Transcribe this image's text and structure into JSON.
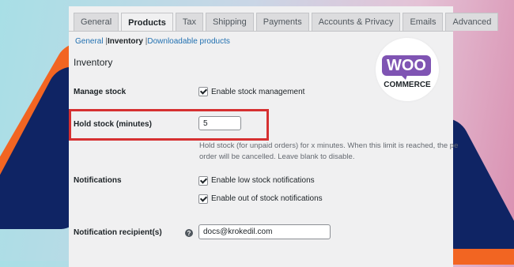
{
  "tabs": [
    {
      "label": "General",
      "active": false
    },
    {
      "label": "Products",
      "active": true
    },
    {
      "label": "Tax",
      "active": false
    },
    {
      "label": "Shipping",
      "active": false
    },
    {
      "label": "Payments",
      "active": false
    },
    {
      "label": "Accounts & Privacy",
      "active": false
    },
    {
      "label": "Emails",
      "active": false
    },
    {
      "label": "Advanced",
      "active": false
    }
  ],
  "subnav": {
    "general": "General",
    "inventory": "Inventory",
    "downloadable": "Downloadable products"
  },
  "section_title": "Inventory",
  "manage_stock": {
    "label": "Manage stock",
    "checkbox_label": "Enable stock management",
    "checked": true
  },
  "hold_stock": {
    "label": "Hold stock (minutes)",
    "value": "5",
    "description_line1": "Hold stock (for unpaid orders) for x minutes. When this limit is reached, the pe",
    "description_line2": "order will be cancelled. Leave blank to disable."
  },
  "notifications": {
    "label": "Notifications",
    "low_stock_label": "Enable low stock notifications",
    "low_stock_checked": true,
    "out_of_stock_label": "Enable out of stock notifications",
    "out_of_stock_checked": true
  },
  "notification_recipient": {
    "label": "Notification recipient(s)",
    "value": "docs@krokedil.com",
    "help_icon": "question-circle-icon"
  },
  "logo": {
    "top": "WOO",
    "bottom": "COMMERCE"
  },
  "colors": {
    "accent_link": "#2271b1",
    "highlight_border": "#d63031",
    "woo_purple": "#7f54b3",
    "deco_orange": "#f26522",
    "deco_navy": "#0f2464"
  }
}
